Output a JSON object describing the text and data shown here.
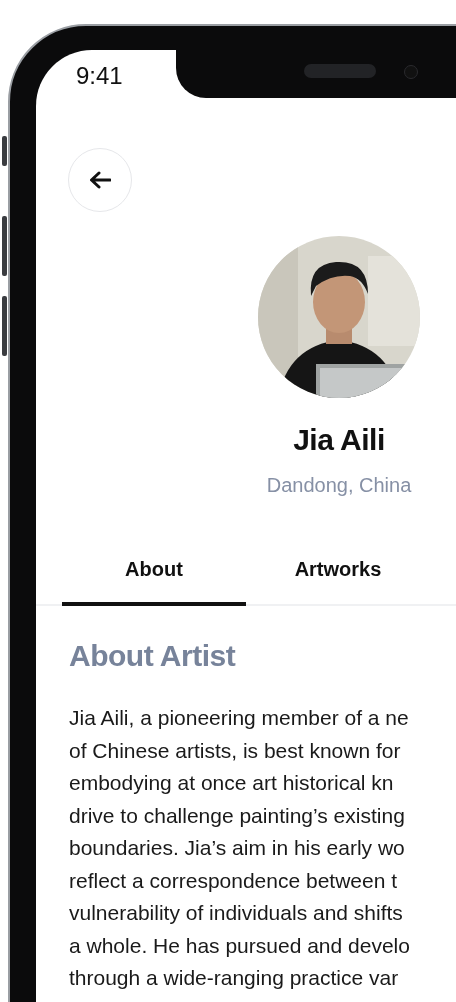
{
  "status_bar": {
    "time": "9:41"
  },
  "profile": {
    "name": "Jia Aili",
    "location": "Dandong, China"
  },
  "tabs": [
    {
      "label": "About",
      "selected": true
    },
    {
      "label": "Artworks",
      "selected": false
    }
  ],
  "about": {
    "heading": "About Artist",
    "lines": [
      "Jia Aili, a pioneering member of a ne",
      "of Chinese artists, is best known for",
      "embodying at once art historical kn",
      "drive to challenge painting’s existing",
      "boundaries. Jia’s aim in his early wo",
      "reflect a correspondence between t",
      "vulnerability of individuals and shifts",
      "a whole. He has pursued and develo",
      "through a wide-ranging practice var"
    ]
  }
}
